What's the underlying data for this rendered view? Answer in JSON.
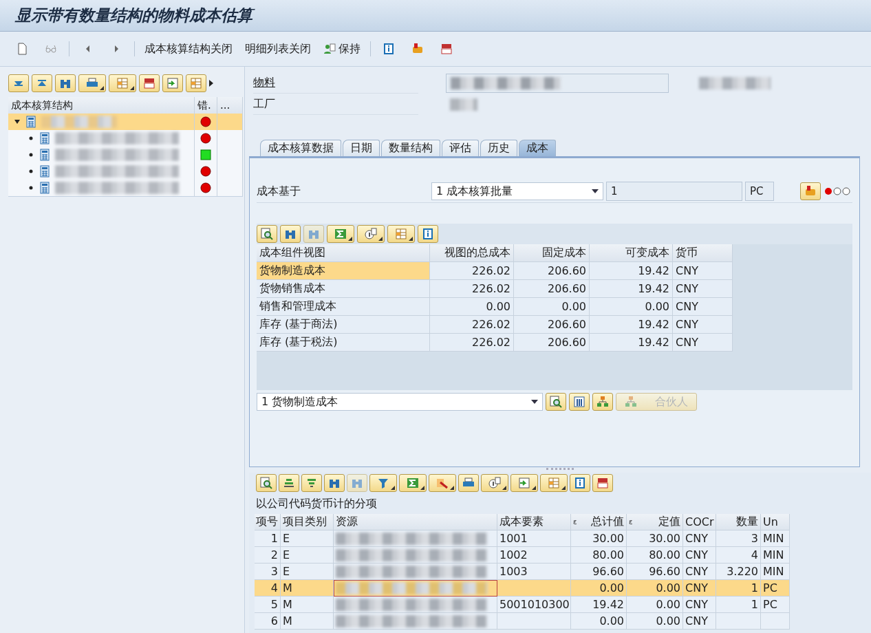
{
  "window": {
    "title": "显示带有数量结构的物料成本估算"
  },
  "toolbar": {
    "buttons": [
      "成本核算结构关闭",
      "明细列表关闭",
      "保持"
    ]
  },
  "tree": {
    "columns": [
      "成本核算结构",
      "错.",
      "..."
    ],
    "rows": [
      {
        "kind": "error",
        "selected": true,
        "children": [
          {
            "kind": "error",
            "selected": false
          },
          {
            "kind": "ok",
            "selected": false
          },
          {
            "kind": "error",
            "selected": false
          },
          {
            "kind": "error",
            "selected": false
          }
        ]
      }
    ]
  },
  "header_fields": [
    {
      "label": "物料"
    },
    {
      "label": "工厂"
    }
  ],
  "tabs": [
    {
      "label": "成本核算数据",
      "selected": false
    },
    {
      "label": "日期",
      "selected": false
    },
    {
      "label": "数量结构",
      "selected": false
    },
    {
      "label": "评估",
      "selected": false
    },
    {
      "label": "历史",
      "selected": false
    },
    {
      "label": "成本",
      "selected": true
    }
  ],
  "cost_basis": {
    "label": "成本基于",
    "dropdown": "1 成本核算批量",
    "quantity": "1",
    "unit": "PC"
  },
  "component_grid": {
    "columns": [
      "成本组件视图",
      "视图的总成本",
      "固定成本",
      "可变成本",
      "货币"
    ],
    "rows": [
      {
        "cells": [
          "货物制造成本",
          "226.02",
          "206.60",
          "19.42",
          "CNY"
        ],
        "selected": true
      },
      {
        "cells": [
          "货物销售成本",
          "226.02",
          "206.60",
          "19.42",
          "CNY"
        ],
        "selected": false
      },
      {
        "cells": [
          "销售和管理成本",
          "0.00",
          "0.00",
          "0.00",
          "CNY"
        ],
        "selected": false
      },
      {
        "cells": [
          "库存 (基于商法)",
          "226.02",
          "206.60",
          "19.42",
          "CNY"
        ],
        "selected": false
      },
      {
        "cells": [
          "库存 (基于税法)",
          "226.02",
          "206.60",
          "19.42",
          "CNY"
        ],
        "selected": false
      }
    ]
  },
  "view_select": {
    "value": "1 货物制造成本",
    "partner_button": {
      "label": "合伙人",
      "disabled": true
    }
  },
  "itemization": {
    "title": "以公司代码货币计的分项",
    "columns": [
      {
        "label": "项号"
      },
      {
        "label": "项目类别"
      },
      {
        "label": "资源"
      },
      {
        "label": "成本要素"
      },
      {
        "label": "总计值",
        "sum": "ε"
      },
      {
        "label": "定值",
        "sum": "ε"
      },
      {
        "label": "COCr"
      },
      {
        "label": "数量"
      },
      {
        "label": "Un"
      }
    ],
    "rows": [
      {
        "cells": [
          "1",
          "E",
          "",
          "1001",
          "30.00",
          "30.00",
          "CNY",
          "3",
          "MIN"
        ],
        "selected": false
      },
      {
        "cells": [
          "2",
          "E",
          "",
          "1002",
          "80.00",
          "80.00",
          "CNY",
          "4",
          "MIN"
        ],
        "selected": false
      },
      {
        "cells": [
          "3",
          "E",
          "",
          "1003",
          "96.60",
          "96.60",
          "CNY",
          "3.220",
          "MIN"
        ],
        "selected": false
      },
      {
        "cells": [
          "4",
          "M",
          "",
          "",
          "0.00",
          "0.00",
          "CNY",
          "1",
          "PC"
        ],
        "selected": true
      },
      {
        "cells": [
          "5",
          "M",
          "",
          "5001010300",
          "19.42",
          "0.00",
          "CNY",
          "1",
          "PC"
        ],
        "selected": false
      },
      {
        "cells": [
          "6",
          "M",
          "",
          "",
          "0.00",
          "0.00",
          "CNY",
          "",
          ""
        ],
        "selected": false
      }
    ]
  }
}
